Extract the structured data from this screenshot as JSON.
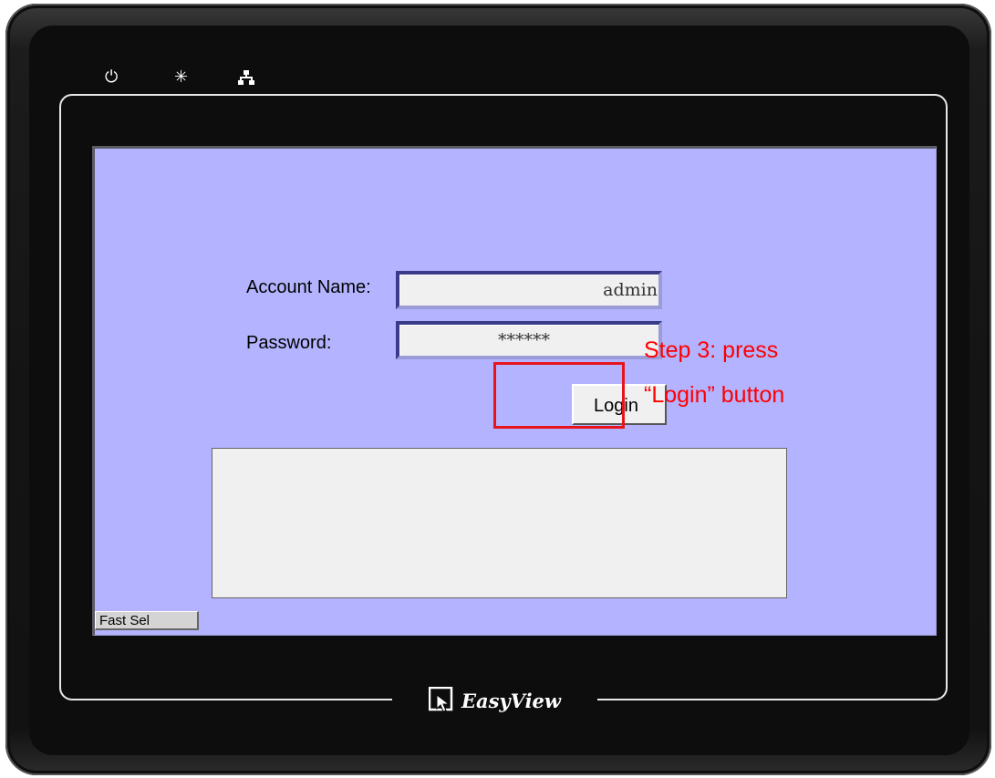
{
  "hmi": {
    "status_icons": {
      "power": "power-icon",
      "brightness": "brightness-icon",
      "network": "network-icon"
    },
    "brand": "EasyView"
  },
  "login_screen": {
    "account_label": "Account Name:",
    "account_value": "admin",
    "password_label": "Password:",
    "password_value": "******",
    "login_button": "Login",
    "fast_select_button": "Fast Sel",
    "background_color": "#b3b3ff"
  },
  "annotation": {
    "line1": "Step 3: press",
    "line2": "“Login” button",
    "color": "#ff0000"
  }
}
